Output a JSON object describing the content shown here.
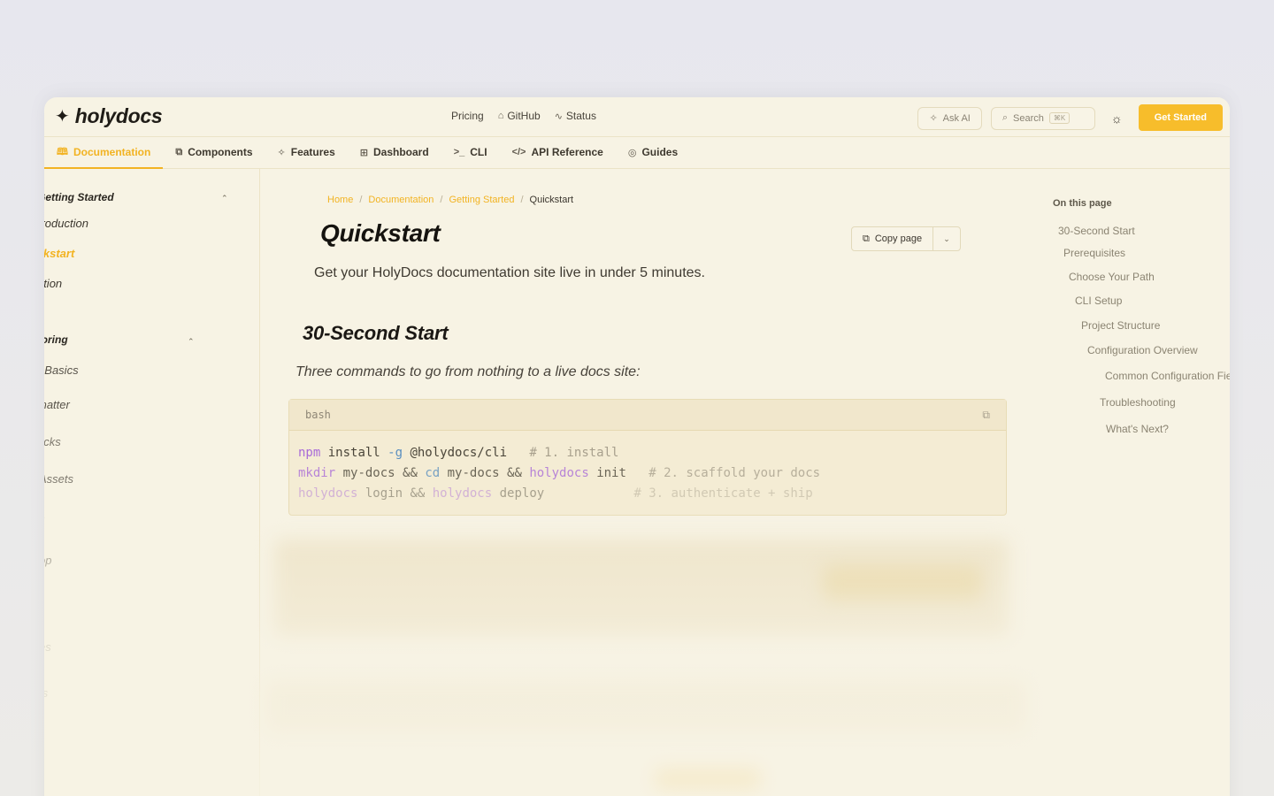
{
  "brand": {
    "name": "holydocs",
    "mark_icon": "sparkle-icon"
  },
  "topnav": [
    {
      "label": "Pricing",
      "icon": ""
    },
    {
      "label": "GitHub",
      "icon": "github-icon"
    },
    {
      "label": "Status",
      "icon": "activity-icon"
    }
  ],
  "actions": {
    "ask_ai": "Ask AI",
    "search": "Search",
    "search_kbd": "⌘K",
    "get_started": "Get Started"
  },
  "tabs": [
    {
      "label": "Documentation",
      "icon": "book-icon",
      "glyph": "🕮",
      "active": true
    },
    {
      "label": "Components",
      "icon": "components-icon",
      "glyph": "⧉",
      "active": false
    },
    {
      "label": "Features",
      "icon": "sparkles-icon",
      "glyph": "✧",
      "active": false
    },
    {
      "label": "Dashboard",
      "icon": "grid-icon",
      "glyph": "⊞",
      "active": false
    },
    {
      "label": "CLI",
      "icon": "terminal-icon",
      "glyph": ">_",
      "active": false
    },
    {
      "label": "API Reference",
      "icon": "code-icon",
      "glyph": "</>",
      "active": false
    },
    {
      "label": "Guides",
      "icon": "compass-icon",
      "glyph": "◎",
      "active": false
    }
  ],
  "sidebar": {
    "sections": [
      {
        "title": "Getting Started",
        "items": [
          "Introduction",
          "Quickstart",
          "Installation"
        ],
        "active": "Quickstart"
      },
      {
        "title": "uthoring",
        "items": [
          "X Basics",
          "matter",
          "ocks",
          "Assets",
          "s",
          "op",
          "es",
          "ts"
        ]
      }
    ]
  },
  "breadcrumb": [
    "Home",
    "Documentation",
    "Getting Started",
    "Quickstart"
  ],
  "page": {
    "title": "Quickstart",
    "copy_page": "Copy page",
    "subtitle": "Get your HolyDocs documentation site live in under 5 minutes.",
    "section_title": "30-Second Start",
    "section_text": "Three commands to go from nothing to a live docs site:"
  },
  "code": {
    "lang": "bash",
    "lines": [
      {
        "cmd": "npm",
        "rest": " install ",
        "flag": "-g",
        "rest2": " @holydocs/cli",
        "comment": "   # 1. install"
      },
      {
        "cmd": "mkdir",
        "rest": " my-docs && ",
        "flag": "cd",
        "rest2": " my-docs && ",
        "cmd2": "holydocs",
        "rest3": " init",
        "comment": "   # 2. scaffold your docs"
      },
      {
        "cmd": "holydocs",
        "rest": " login && ",
        "cmd2": "holydocs",
        "rest2": " deploy",
        "comment": "            # 3. authenticate + ship"
      }
    ]
  },
  "toc": {
    "title": "On this page",
    "items": [
      "30-Second Start",
      "Prerequisites",
      "Choose Your Path",
      "CLI Setup",
      "Project Structure",
      "Configuration Overview",
      "Common Configuration Fields",
      "Troubleshooting",
      "What's Next?"
    ]
  },
  "colors": {
    "accent": "#f2b322",
    "background": "#f7f3e4",
    "button": "#f7bd2b"
  }
}
